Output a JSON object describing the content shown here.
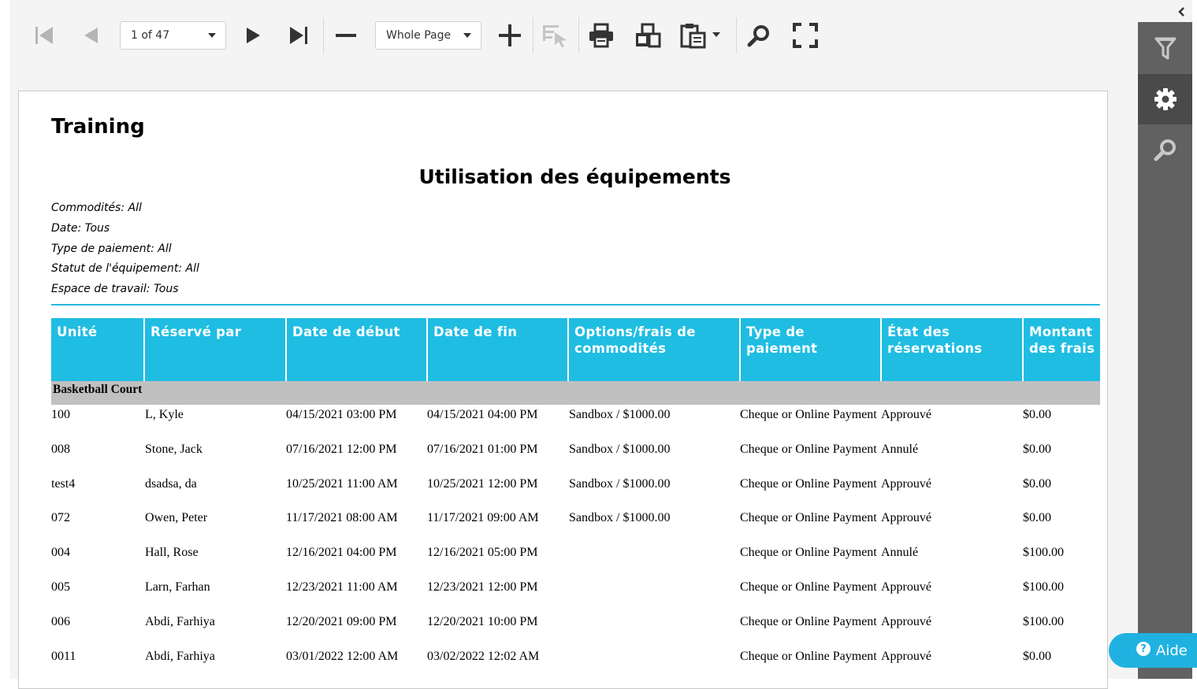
{
  "toolbar": {
    "page_indicator": "1 of 47",
    "zoom_mode": "Whole Page"
  },
  "report": {
    "company": "Training",
    "title": "Utilisation des équipements",
    "filters": [
      "Commodités: All",
      "Date: Tous",
      "Type de paiement: All",
      "Statut de l'équipement: All",
      "Espace de travail: Tous"
    ],
    "columns": [
      "Unité",
      "Réservé par",
      "Date de début",
      "Date de fin",
      "Options/frais de commodités",
      "Type de paiement",
      "État des réservations",
      "Montant des frais"
    ],
    "group": "Basketball Court",
    "rows": [
      [
        "100",
        "L, Kyle",
        "04/15/2021 03:00 PM",
        "04/15/2021 04:00 PM",
        "Sandbox / $1000.00",
        "Cheque or Online Payment",
        "Approuvé",
        "$0.00"
      ],
      [
        "008",
        "Stone, Jack",
        "07/16/2021 12:00 PM",
        "07/16/2021 01:00 PM",
        "Sandbox / $1000.00",
        "Cheque or Online Payment",
        "Annulé",
        "$0.00"
      ],
      [
        "test4",
        "dsadsa, da",
        "10/25/2021 11:00 AM",
        "10/25/2021 12:00 PM",
        "Sandbox / $1000.00",
        "Cheque or Online Payment",
        "Approuvé",
        "$0.00"
      ],
      [
        "072",
        "Owen, Peter",
        "11/17/2021 08:00 AM",
        "11/17/2021 09:00 AM",
        "Sandbox / $1000.00",
        "Cheque or Online Payment",
        "Approuvé",
        "$0.00"
      ],
      [
        "004",
        "Hall, Rose",
        "12/16/2021 04:00 PM",
        "12/16/2021 05:00 PM",
        "",
        "Cheque or Online Payment",
        "Annulé",
        "$100.00"
      ],
      [
        "005",
        "Larn, Farhan",
        "12/23/2021 11:00 AM",
        "12/23/2021 12:00 PM",
        "",
        "Cheque or Online Payment",
        "Approuvé",
        "$100.00"
      ],
      [
        "006",
        "Abdi, Farhiya",
        "12/20/2021 09:00 PM",
        "12/20/2021 10:00 PM",
        "",
        "Cheque or Online Payment",
        "Approuvé",
        "$100.00"
      ],
      [
        "0011",
        "Abdi, Farhiya",
        "03/01/2022 12:00 AM",
        "03/02/2022 12:02 AM",
        "",
        "Cheque or Online Payment",
        "Approuvé",
        "$0.00"
      ]
    ]
  },
  "help": {
    "label": "Aide",
    "icon_glyph": "?"
  },
  "colors": {
    "accent": "#1fbde2",
    "group_bg": "#c0c0c0",
    "panel": "#616161",
    "help": "#1fb2e0"
  }
}
